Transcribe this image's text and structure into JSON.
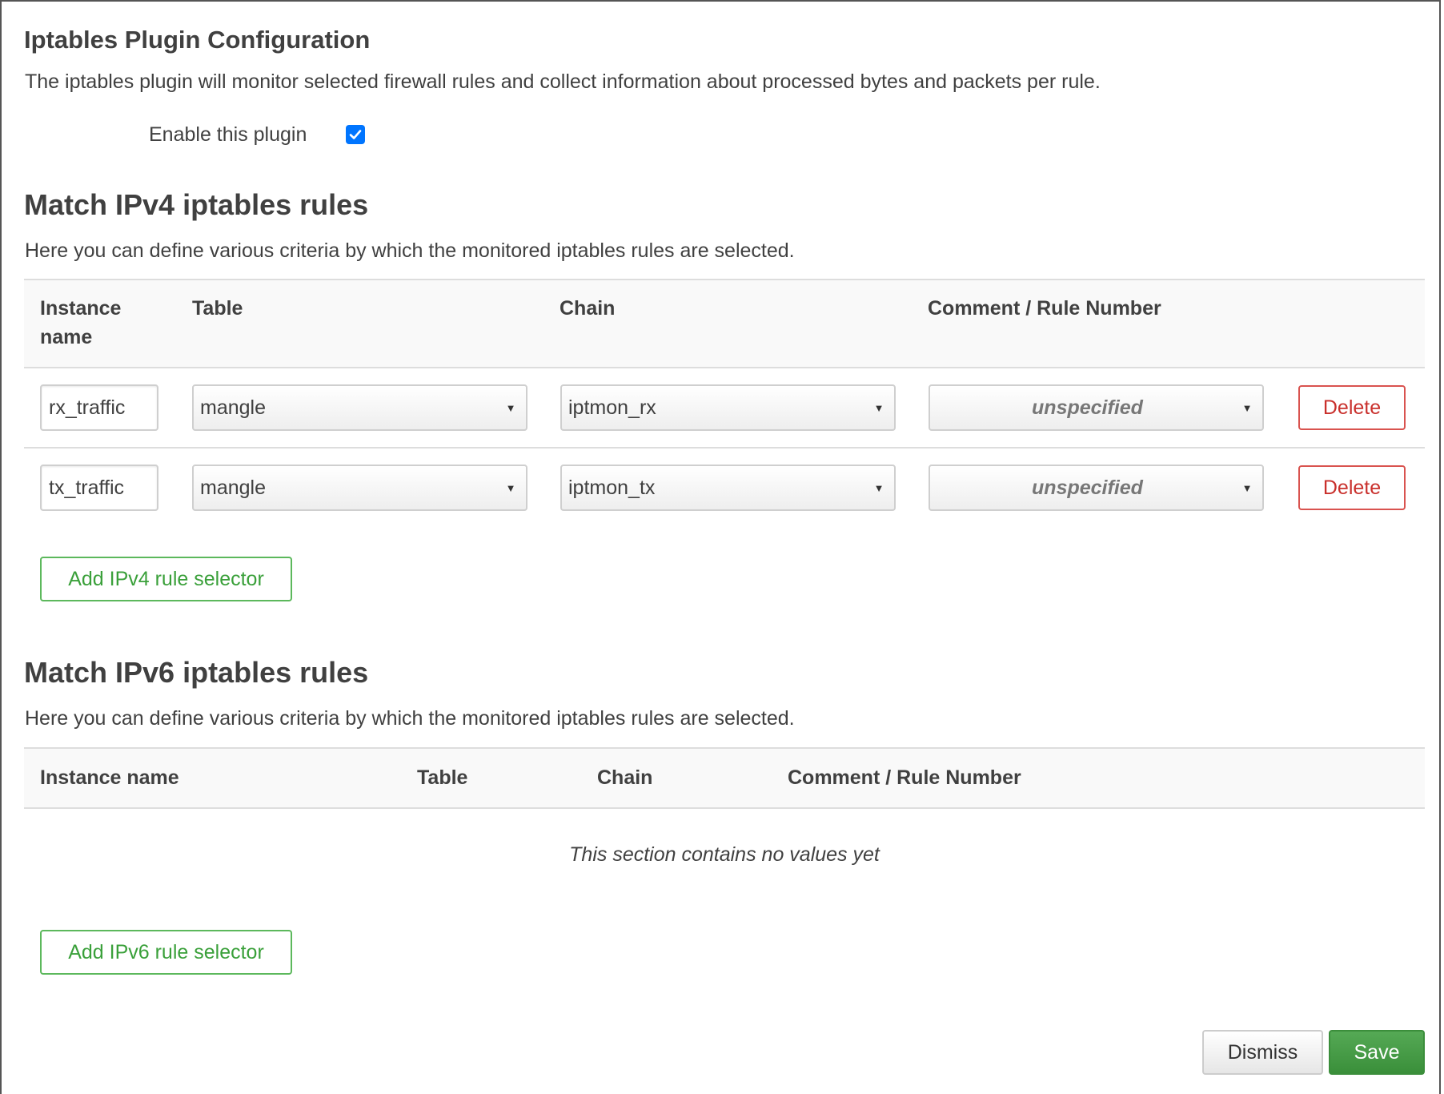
{
  "dialog": {
    "title": "Iptables Plugin Configuration",
    "description": "The iptables plugin will monitor selected firewall rules and collect information about processed bytes and packets per rule.",
    "enable_label": "Enable this plugin",
    "enable_checked": true
  },
  "ipv4": {
    "title": "Match IPv4 iptables rules",
    "description": "Here you can define various criteria by which the monitored iptables rules are selected.",
    "columns": {
      "instance_line1": "Instance",
      "instance_line2": "name",
      "table": "Table",
      "chain": "Chain",
      "comment": "Comment / Rule Number"
    },
    "rows": [
      {
        "instance": "rx_traffic",
        "table": "mangle",
        "chain": "iptmon_rx",
        "comment": "unspecified",
        "delete_label": "Delete"
      },
      {
        "instance": "tx_traffic",
        "table": "mangle",
        "chain": "iptmon_tx",
        "comment": "unspecified",
        "delete_label": "Delete"
      }
    ],
    "add_label": "Add IPv4 rule selector"
  },
  "ipv6": {
    "title": "Match IPv6 iptables rules",
    "description": "Here you can define various criteria by which the monitored iptables rules are selected.",
    "columns": {
      "instance": "Instance name",
      "table": "Table",
      "chain": "Chain",
      "comment": "Comment / Rule Number"
    },
    "empty_text": "This section contains no values yet",
    "add_label": "Add IPv6 rule selector"
  },
  "footer": {
    "dismiss_label": "Dismiss",
    "save_label": "Save"
  },
  "colors": {
    "add_button": "#5cb85c",
    "delete_button": "#d9534f",
    "save_button": "#3a8f3a",
    "checkbox": "#0075ff"
  }
}
